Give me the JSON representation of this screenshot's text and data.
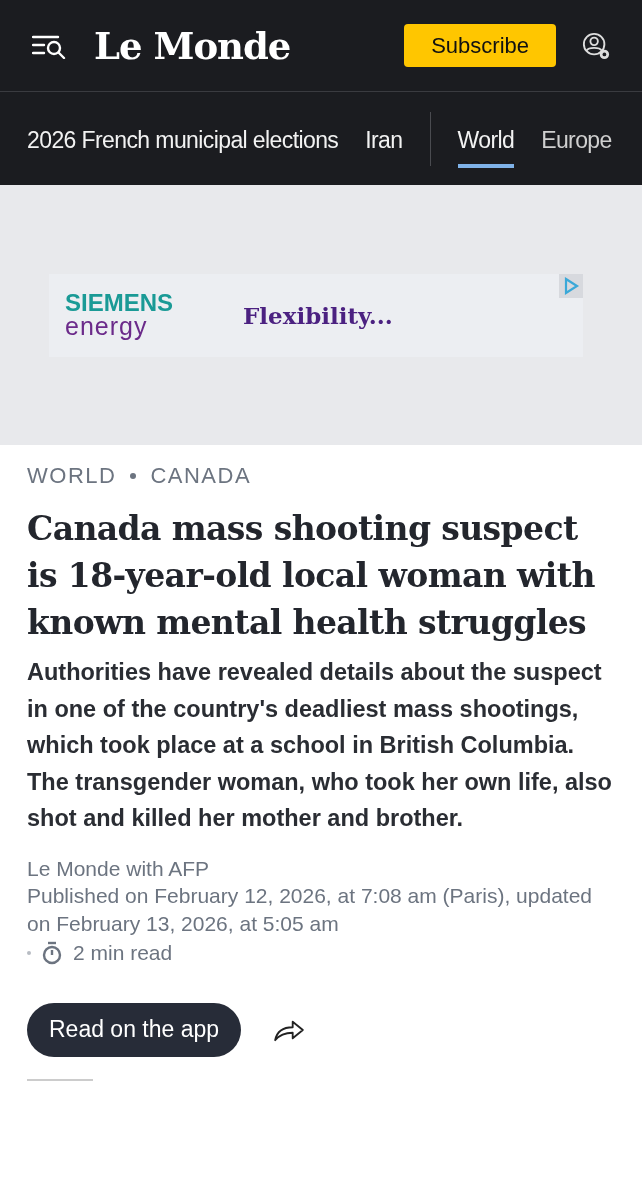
{
  "header": {
    "logo": "Le Monde",
    "subscribe": "Subscribe"
  },
  "nav": [
    {
      "label": "2026 French municipal elections",
      "selected": false
    },
    {
      "label": "Iran",
      "selected": false
    },
    {
      "label": "World",
      "selected": true
    },
    {
      "label": "Europe",
      "selected": false
    }
  ],
  "ad": {
    "brand_top": "SIEMENS",
    "brand_bottom": "energy",
    "tagline": "Flexibility..."
  },
  "article": {
    "kicker": [
      "WORLD",
      "CANADA"
    ],
    "headline": "Canada mass shooting suspect is 18-year-old local woman with known mental health struggles",
    "summary": "Authorities have revealed details about the suspect in one of the country's deadliest mass shootings, which took place at a school in British Columbia. The transgender woman, who took her own life, also shot and killed her mother and brother.",
    "author": "Le Monde with AFP",
    "dates": "Published on February 12, 2026, at 7:08 am (Paris), updated on February 13, 2026, at 5:05 am",
    "read_time": "2 min read",
    "app_button": "Read on the app"
  }
}
